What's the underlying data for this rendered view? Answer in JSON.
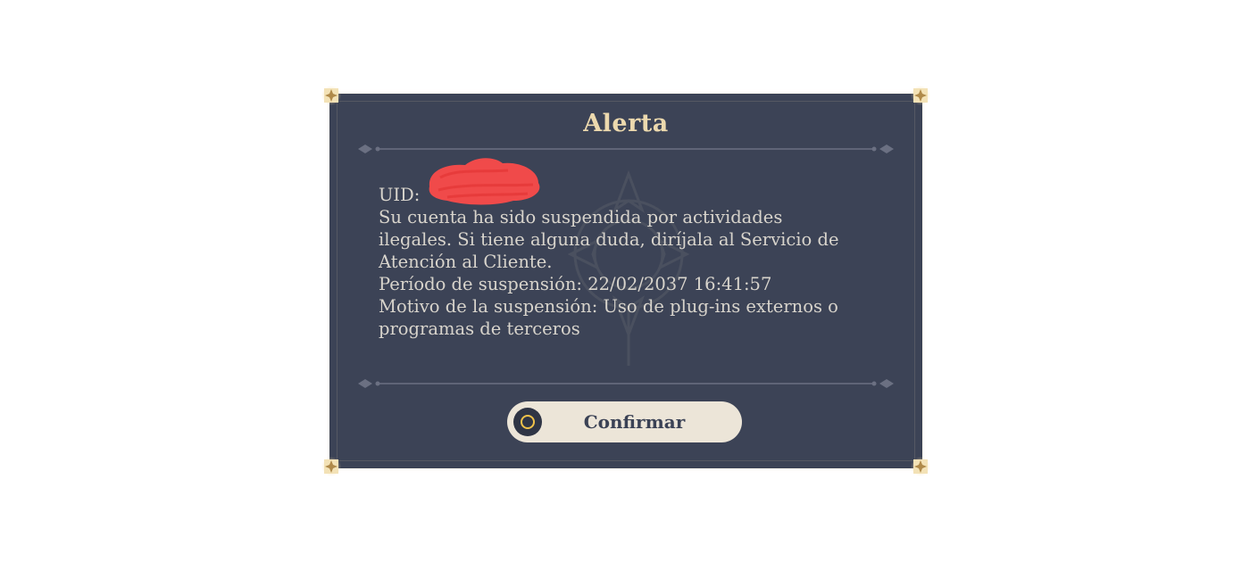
{
  "dialog": {
    "title": "Alerta",
    "uid_label": "UID:",
    "lines": [
      "Su cuenta ha sido suspendida por actividades",
      "ilegales. Si tiene alguna duda, diríjala al Servicio de",
      "Atención al Cliente.",
      "Período de suspensión: 22/02/2037 16:41:57",
      "Motivo de la suspensión: Uso de plug-ins externos o",
      "programas de terceros"
    ],
    "confirm_label": "Confirmar",
    "confirm_icon": "circle-button-icon"
  },
  "colors": {
    "panel": "#3c4356",
    "title": "#ecd9ae",
    "text": "#d8d4cc",
    "button": "#ece5d8",
    "redaction": "#f04a4a"
  }
}
